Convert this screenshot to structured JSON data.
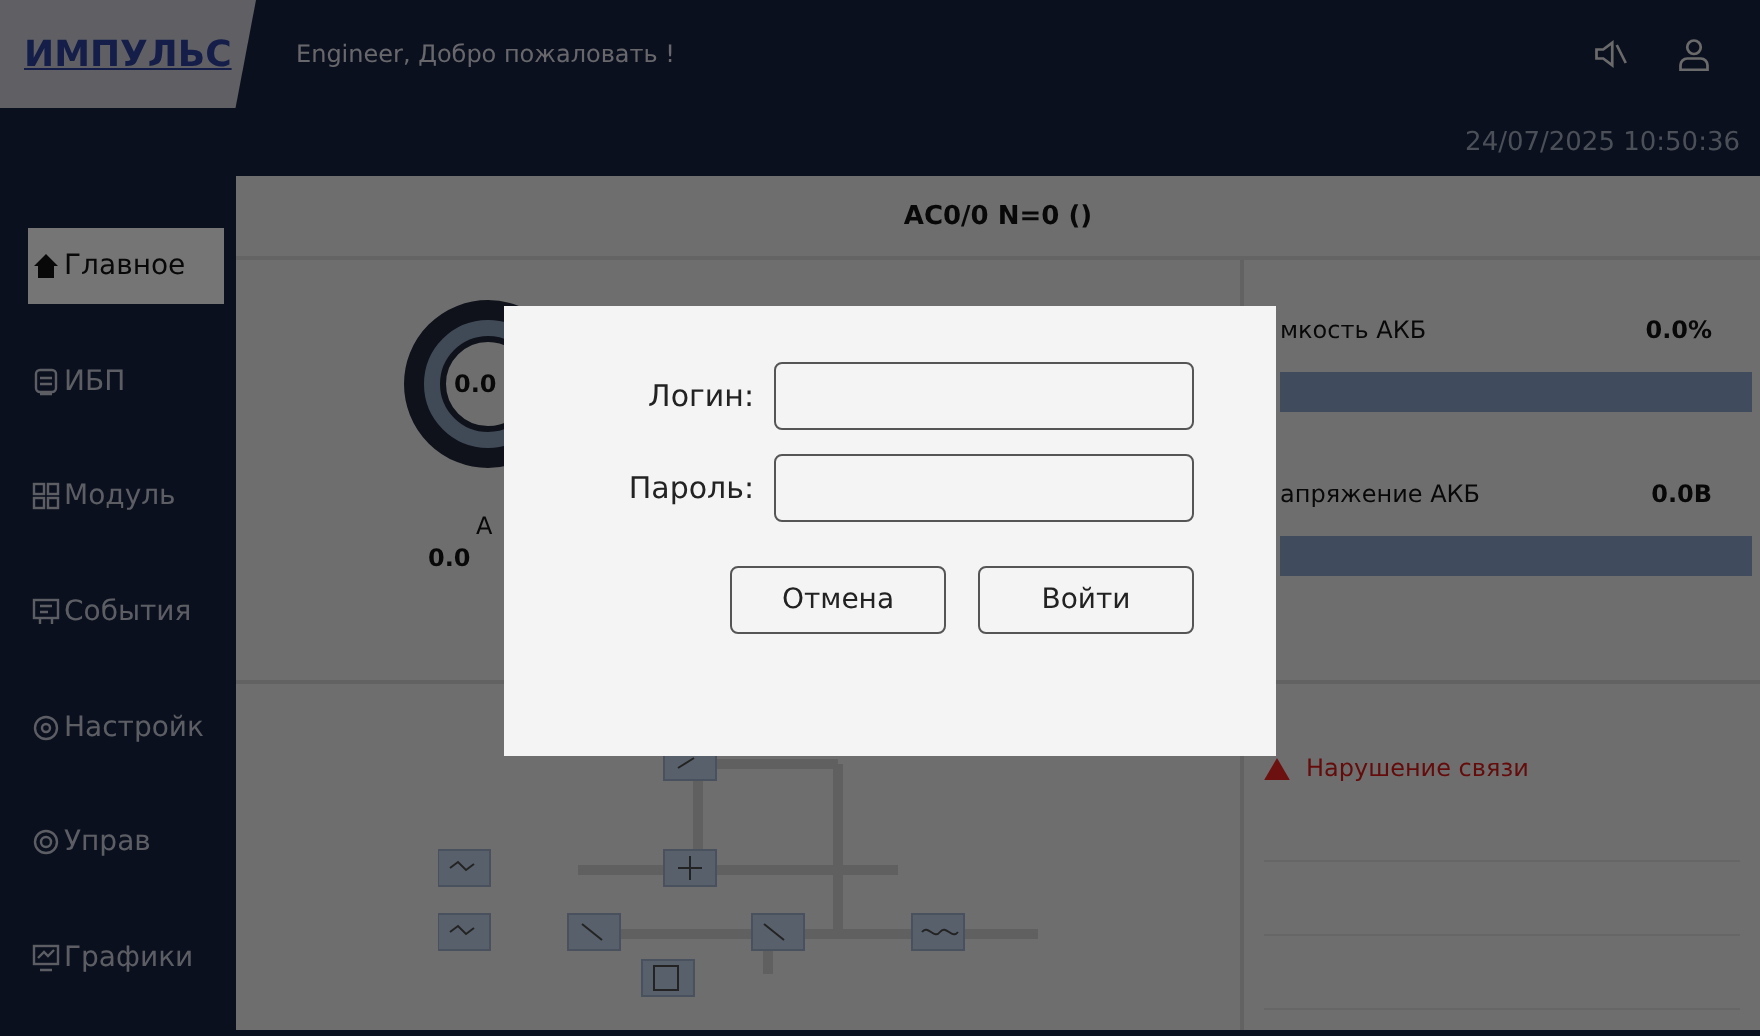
{
  "header": {
    "logo": "ИМПУЛЬС",
    "welcome": "Engineer, Добро пожаловать !",
    "datetime": "24/07/2025  10:50:36"
  },
  "sidebar": {
    "items": [
      {
        "label": "Главное",
        "selected": true
      },
      {
        "label": "ИБП",
        "selected": false
      },
      {
        "label": "Модуль",
        "selected": false
      },
      {
        "label": "События",
        "selected": false
      },
      {
        "label": "Настройк",
        "selected": false
      },
      {
        "label": "Управ",
        "selected": false
      },
      {
        "label": "Графики",
        "selected": false
      }
    ]
  },
  "title": "AC0/0 N=0 ()",
  "gauge": {
    "value": "0.0",
    "label": "А",
    "reading": "0.0"
  },
  "battery": [
    {
      "label": "мкость АКБ",
      "value": "0.0%",
      "level": 0
    },
    {
      "label": "апряжение АКБ",
      "value": "0.0B",
      "level": 0
    }
  ],
  "alarms": [
    {
      "text": "Нарушение связи"
    }
  ],
  "login_dialog": {
    "fields": [
      {
        "label": "Логин:"
      },
      {
        "label": "Пароль:"
      }
    ],
    "buttons": [
      "Отмена",
      "Войти"
    ]
  }
}
